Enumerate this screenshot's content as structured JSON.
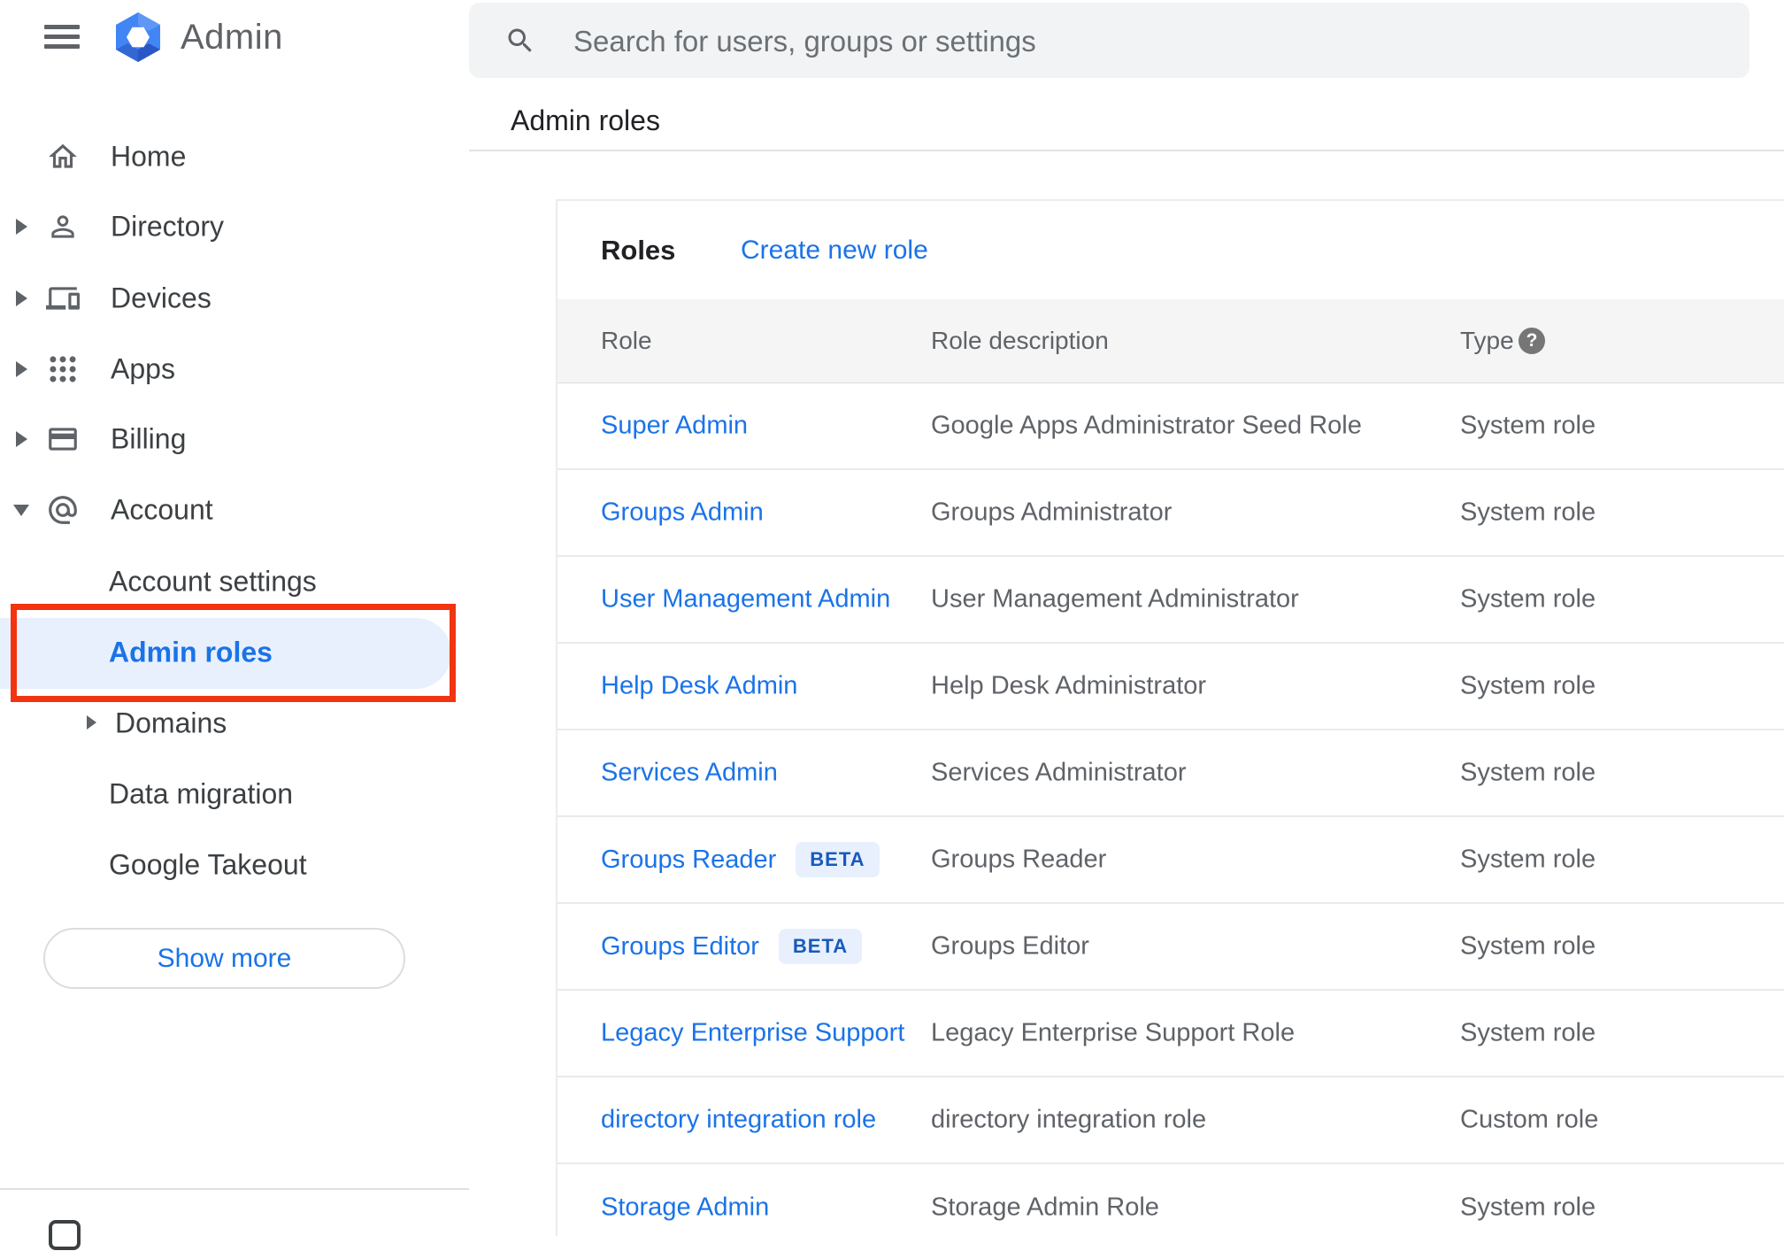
{
  "sidebar": {
    "logo_text": "Admin",
    "items": [
      {
        "label": "Home"
      },
      {
        "label": "Directory"
      },
      {
        "label": "Devices"
      },
      {
        "label": "Apps"
      },
      {
        "label": "Billing"
      },
      {
        "label": "Account"
      }
    ],
    "account_subitems": [
      {
        "label": "Account settings"
      },
      {
        "label": "Admin roles",
        "selected": true
      },
      {
        "label": "Domains"
      },
      {
        "label": "Data migration"
      },
      {
        "label": "Google Takeout"
      }
    ],
    "show_more_label": "Show more"
  },
  "search": {
    "placeholder": "Search for users, groups or settings",
    "icon": "search-icon"
  },
  "breadcrumb": "Admin roles",
  "main": {
    "title": "Roles",
    "create_link": "Create new role",
    "table": {
      "headers": {
        "role": "Role",
        "description": "Role description",
        "type": "Type",
        "type_help_icon": "help-icon"
      },
      "rows": [
        {
          "role": "Super Admin",
          "description": "Google Apps Administrator Seed Role",
          "type": "System role"
        },
        {
          "role": "Groups Admin",
          "description": "Groups Administrator",
          "type": "System role"
        },
        {
          "role": "User Management Admin",
          "description": "User Management Administrator",
          "type": "System role"
        },
        {
          "role": "Help Desk Admin",
          "description": "Help Desk Administrator",
          "type": "System role"
        },
        {
          "role": "Services Admin",
          "description": "Services Administrator",
          "type": "System role"
        },
        {
          "role": "Groups Reader",
          "badge": "BETA",
          "description": "Groups Reader",
          "type": "System role"
        },
        {
          "role": "Groups Editor",
          "badge": "BETA",
          "description": "Groups Editor",
          "type": "System role"
        },
        {
          "role": "Legacy Enterprise Support",
          "description": "Legacy Enterprise Support Role",
          "type": "System role"
        },
        {
          "role": "directory integration role",
          "description": "directory integration role",
          "type": "Custom role"
        },
        {
          "role": "Storage Admin",
          "description": "Storage Admin Role",
          "type": "System role"
        }
      ]
    }
  },
  "colors": {
    "accent_blue": "#1a73e8",
    "annotation_red": "#f23411",
    "selected_pill_bg": "#e8f0fe",
    "badge_bg": "#e8f0fe",
    "badge_text": "#185abc",
    "table_header_bg": "#f5f5f5",
    "searchbar_bg": "#f1f3f4",
    "text_gray": "#5f6368"
  }
}
